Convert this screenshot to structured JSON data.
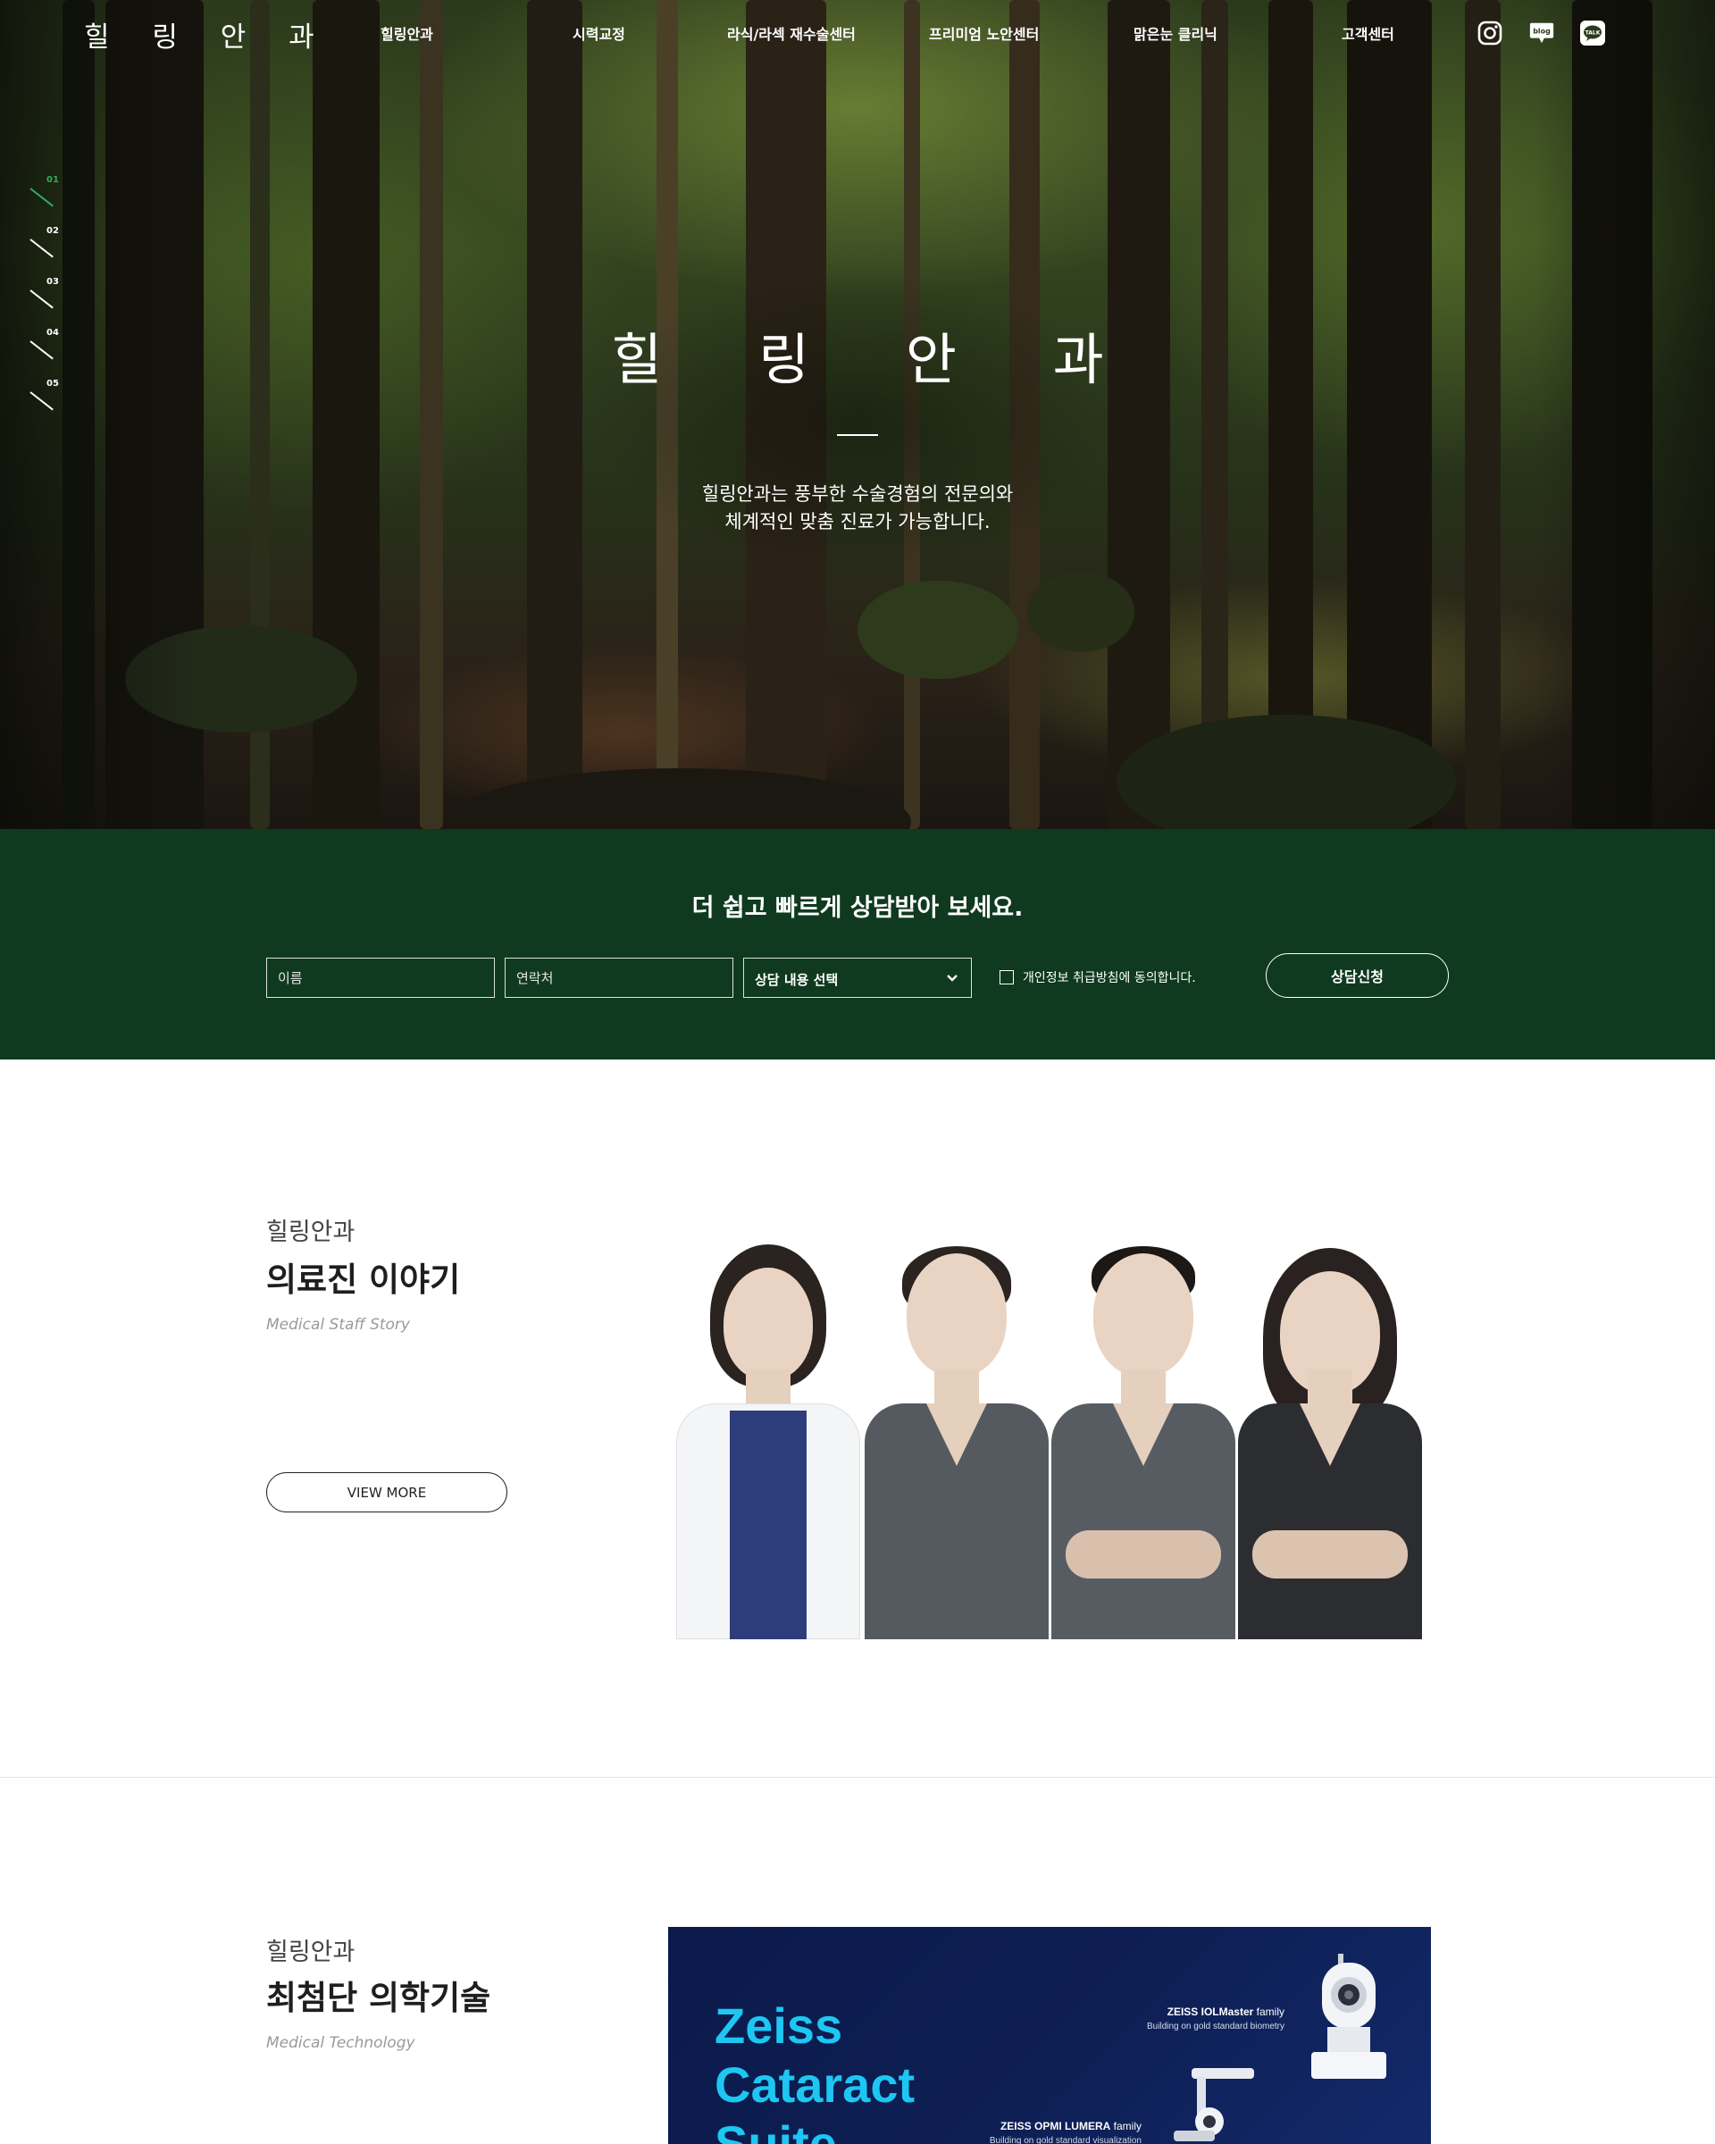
{
  "header": {
    "logo": "힐 링 안 과",
    "nav": [
      "힐링안과",
      "시력교정",
      "라식/라섹 재수술센터",
      "프리미엄 노안센터",
      "맑은눈 클리닉",
      "고객센터"
    ],
    "social": [
      {
        "icon": "instagram-icon"
      },
      {
        "icon": "blog-icon",
        "label": "blog"
      },
      {
        "icon": "kakao-talk-icon",
        "label": "TALK"
      }
    ]
  },
  "pager": [
    "01",
    "02",
    "03",
    "04",
    "05"
  ],
  "hero": {
    "title": "힐 링 안 과",
    "desc_line1": "힐링안과는 풍부한 수술경험의 전문의와",
    "desc_line2": "체계적인 맞춤 진료가 가능합니다."
  },
  "consult": {
    "title": "더 쉽고 빠르게 상담받아 보세요.",
    "name_placeholder": "이름",
    "phone_placeholder": "연락처",
    "select_value": "상담 내용 선택",
    "agree_label": "개인정보 취급방침에 동의합니다.",
    "submit_label": "상담신청"
  },
  "staff": {
    "sub": "힐링안과",
    "title": "의료진 이야기",
    "eng": "Medical Staff Story",
    "button": "VIEW MORE"
  },
  "tech": {
    "sub": "힐링안과",
    "title": "최첨단 의학기술",
    "eng": "Medical Technology",
    "banner": {
      "brand_line1": "Zeiss",
      "brand_line2": "Cataract",
      "brand_line3": "Suite",
      "cap1_bold": "ZEISS IOLMaster",
      "cap1_family": "family",
      "cap1_sub": "Building on gold standard biometry",
      "cap2_bold": "ZEISS OPMI LUMERA",
      "cap2_family": "family",
      "cap2_sub": "Building on gold standard visualization"
    }
  },
  "colors": {
    "consult_bg": "#0f3a1f",
    "pager_active": "#2fae5f",
    "banner_bg": "#0e1f55",
    "banner_text": "#1ec6f2"
  }
}
